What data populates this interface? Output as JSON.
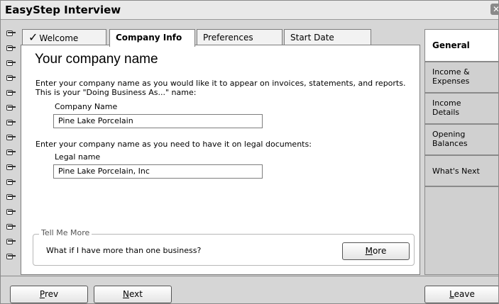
{
  "window": {
    "title": "EasyStep Interview",
    "close_glyph": "✕"
  },
  "notebook_tabs": [
    {
      "label": "Welcome",
      "completed": true
    },
    {
      "label": "Company Info",
      "active": true
    },
    {
      "label": "Preferences"
    },
    {
      "label": "Start Date"
    }
  ],
  "page": {
    "title": "Your company name",
    "intro_line1": "Enter your company name as you would like it to appear on invoices, statements, and reports.",
    "intro_line2": "This is your \"Doing Business As...\" name:",
    "company_name_label": "Company Name",
    "company_name_value": "Pine Lake Porcelain",
    "legal_intro": "Enter your company name as you need to have it on legal documents:",
    "legal_name_label": "Legal name",
    "legal_name_value": "Pine Lake Porcelain, Inc"
  },
  "tell_me_more": {
    "legend": "Tell Me More",
    "question": "What if I have more than one business?",
    "more_button": {
      "mnemonic": "M",
      "rest": "ore"
    }
  },
  "side_tabs": [
    {
      "line1": "General",
      "line2": "",
      "active": true
    },
    {
      "line1": "Income &",
      "line2": "Expenses"
    },
    {
      "line1": "Income",
      "line2": "Details"
    },
    {
      "line1": "Opening",
      "line2": "Balances"
    },
    {
      "line1": "What's Next",
      "line2": ""
    }
  ],
  "footer": {
    "prev": {
      "mnemonic": "P",
      "rest": "rev"
    },
    "next": {
      "mnemonic": "N",
      "rest": "ext"
    },
    "leave": {
      "mnemonic": "L",
      "rest": "eave"
    }
  },
  "icons": {
    "binder": "binder-ring-icon",
    "check": "checkmark-icon",
    "close": "close-icon"
  }
}
